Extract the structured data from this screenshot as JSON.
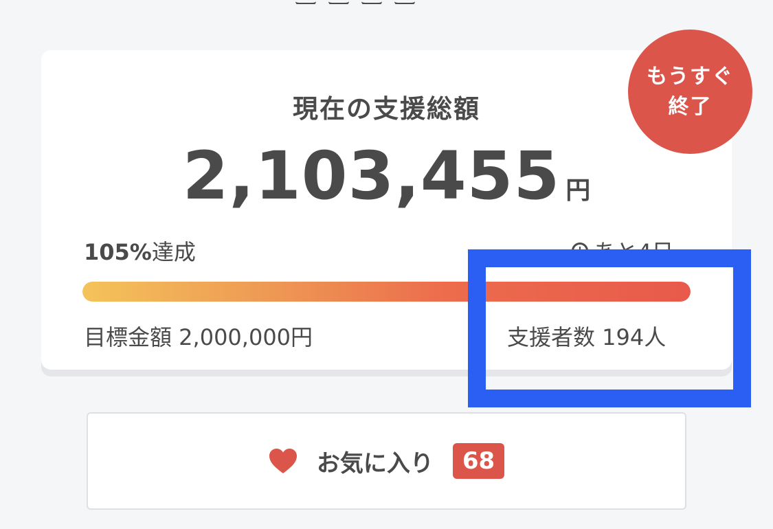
{
  "summary_card": {
    "title": "現在の支援総額",
    "amount": "2,103,455",
    "amount_unit": "円",
    "achievement_percent": "105%",
    "achievement_suffix": "達成",
    "progress_fraction": 1.0,
    "remaining_label": "あと4日",
    "goal_label": "目標金額 2,000,000円",
    "supporters_label": "支援者数 194人"
  },
  "badge": {
    "line1": "もうすぐ",
    "line2": "終了"
  },
  "favorite": {
    "label": "お気に入り",
    "count": "68"
  },
  "colors": {
    "accent_red": "#dc554b",
    "progress_start": "#f4c35a",
    "progress_end": "#e85a4b",
    "highlight_blue": "#2b5ff3"
  },
  "icons": {
    "clock": "clock-icon",
    "heart": "heart-icon"
  }
}
